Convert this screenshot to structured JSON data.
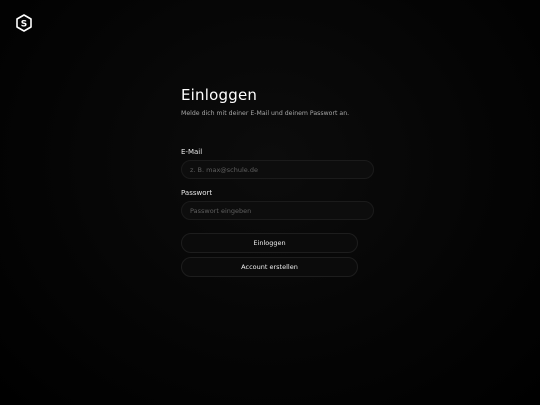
{
  "brand": {
    "logo_letter": "S",
    "logo_icon": "hexagon-s-logo"
  },
  "login": {
    "title": "Einloggen",
    "subtitle": "Melde dich mit deiner E-Mail und deinem Passwort an.",
    "email_label": "E-Mail",
    "email_placeholder": "z. B. max@schule.de",
    "email_value": "",
    "password_label": "Passwort",
    "password_placeholder": "Passwort eingeben",
    "password_value": "",
    "login_button": "Einloggen",
    "create_account_button": "Account erstellen"
  },
  "colors": {
    "background": "#000000",
    "text": "#ffffff",
    "muted_text": "#a6a6a6",
    "field_background": "#0d0d0d",
    "field_border": "#1b1b1b"
  }
}
